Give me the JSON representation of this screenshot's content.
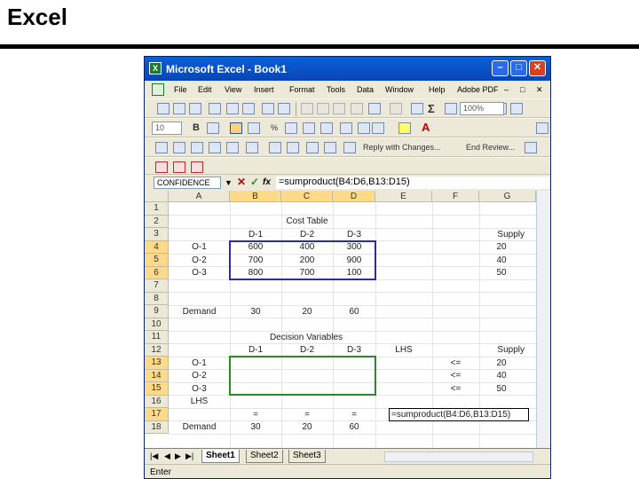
{
  "slide": {
    "title": "Excel"
  },
  "window": {
    "title": "Microsoft Excel - Book1"
  },
  "menu": [
    "File",
    "Edit",
    "View",
    "Insert",
    "Format",
    "Tools",
    "Data",
    "Window",
    "Help",
    "Adobe PDF"
  ],
  "toolbar": {
    "zoom": "100%",
    "font_size": "10",
    "reply_label": "Reply with Changes...",
    "end_review_label": "End Review..."
  },
  "formula_bar": {
    "name_box": "CONFIDENCE",
    "fx": "fx",
    "formula": "=sumproduct(B4:D6,B13:D15)"
  },
  "columns": [
    "A",
    "B",
    "C",
    "D",
    "E",
    "F",
    "G"
  ],
  "rows": [
    "1",
    "2",
    "3",
    "4",
    "5",
    "6",
    "7",
    "8",
    "9",
    "10",
    "11",
    "12",
    "13",
    "14",
    "15",
    "16",
    "17",
    "18"
  ],
  "cells": {
    "cost_table_title": "Cost Table",
    "cost_headers": [
      "D-1",
      "D-2",
      "D-3"
    ],
    "supply_header": "Supply",
    "origins": [
      "O-1",
      "O-2",
      "O-3"
    ],
    "costs": [
      [
        "600",
        "400",
        "300"
      ],
      [
        "700",
        "200",
        "900"
      ],
      [
        "800",
        "700",
        "100"
      ]
    ],
    "supplies": [
      "20",
      "40",
      "50"
    ],
    "demand_label": "Demand",
    "demands": [
      "30",
      "20",
      "60"
    ],
    "decision_title": "Decision Variables",
    "decision_headers": [
      "D-1",
      "D-2",
      "D-3"
    ],
    "lhs_header": "LHS",
    "supply_header2": "Supply",
    "decision_origins": [
      "O-1",
      "O-2",
      "O-3"
    ],
    "leq": [
      "<=",
      "<=",
      "<="
    ],
    "supplies2": [
      "20",
      "40",
      "50"
    ],
    "lhs_label": "LHS",
    "eq": [
      "=",
      "=",
      "="
    ],
    "editing_formula": "=sumproduct(B4:D6,B13:D15)",
    "demand_label2": "Demand",
    "demands2": [
      "30",
      "20",
      "60"
    ]
  },
  "sheets": [
    "Sheet1",
    "Sheet2",
    "Sheet3"
  ],
  "status": "Enter"
}
